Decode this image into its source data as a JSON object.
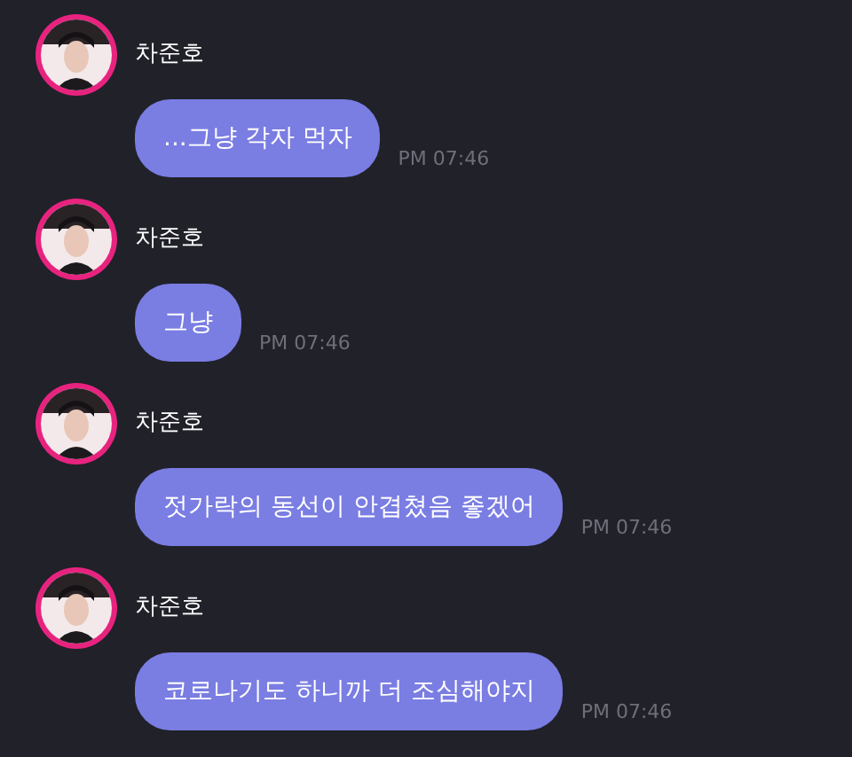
{
  "messages": [
    {
      "sender": "차준호",
      "text": "...그냥 각자 먹자",
      "time": "PM 07:46"
    },
    {
      "sender": "차준호",
      "text": "그냥",
      "time": "PM 07:46"
    },
    {
      "sender": "차준호",
      "text": "젓가락의 동선이 안겹쳤음 좋겠어",
      "time": "PM 07:46"
    },
    {
      "sender": "차준호",
      "text": "코로나기도 하니까 더 조심해야지",
      "time": "PM 07:46"
    }
  ]
}
